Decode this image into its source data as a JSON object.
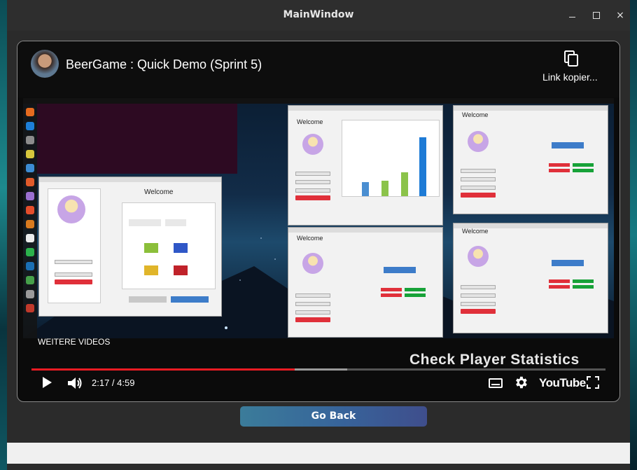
{
  "window": {
    "title": "MainWindow",
    "minimize_label": "",
    "maximize_label": "",
    "close_label": "×"
  },
  "video": {
    "title": "BeerGame : Quick Demo (Sprint 5)",
    "copy_link_label": "Link kopier...",
    "more_videos_label": "WEITERE VIDEOS",
    "caption": "Check Player Statistics",
    "time_display": "2:17 / 4:59",
    "progress_fraction": 0.4581,
    "buffered_fraction": 0.55,
    "youtube_label": "YouTube"
  },
  "footer": {
    "go_back_label": "Go Back"
  },
  "colors": {
    "accent_red": "#e91b23",
    "button_gradient_start": "#3b7c9a",
    "button_gradient_end": "#3f4e8c",
    "window_bg": "#2b2b2b"
  },
  "icons": [
    "copy-icon",
    "play-icon",
    "volume-icon",
    "subtitles-icon",
    "settings-icon",
    "fullscreen-icon",
    "close-icon",
    "minimize-icon",
    "maximize-icon"
  ]
}
